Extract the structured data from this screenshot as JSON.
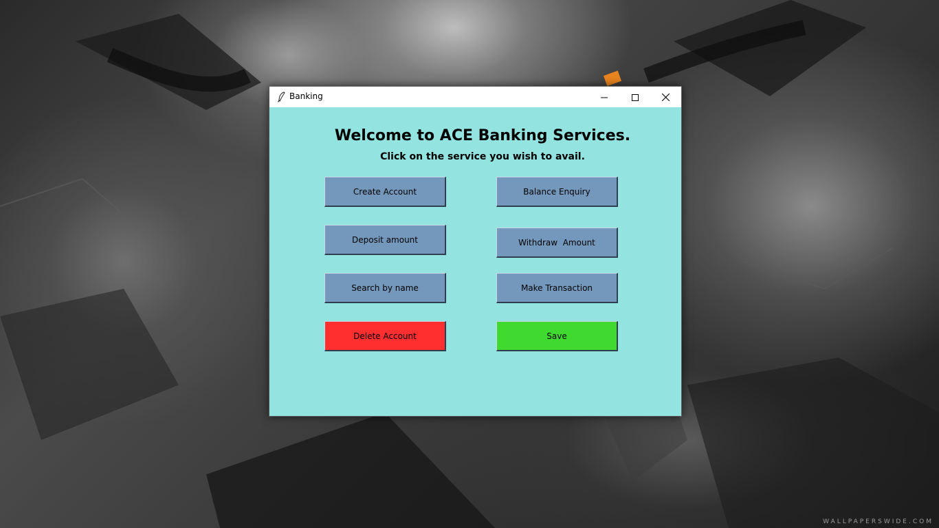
{
  "window": {
    "title": "Banking"
  },
  "main": {
    "heading": "Welcome to ACE Banking Services.",
    "subheading": "Click on the service you wish to avail."
  },
  "buttons": {
    "create_account": "Create Account",
    "balance_enquiry": "Balance Enquiry",
    "deposit_amount": "Deposit amount",
    "withdraw_amount": "Withdraw  Amount",
    "search_by_name": "Search by name",
    "make_transaction": "Make Transaction",
    "delete_account": "Delete Account",
    "save": "Save"
  },
  "colors": {
    "window_background": "#93e3e0",
    "default_button": "#7398bc",
    "delete_button": "#ff2f2f",
    "save_button": "#3fd92f"
  },
  "desktop": {
    "watermark": "WALLPAPERSWIDE.COM"
  }
}
